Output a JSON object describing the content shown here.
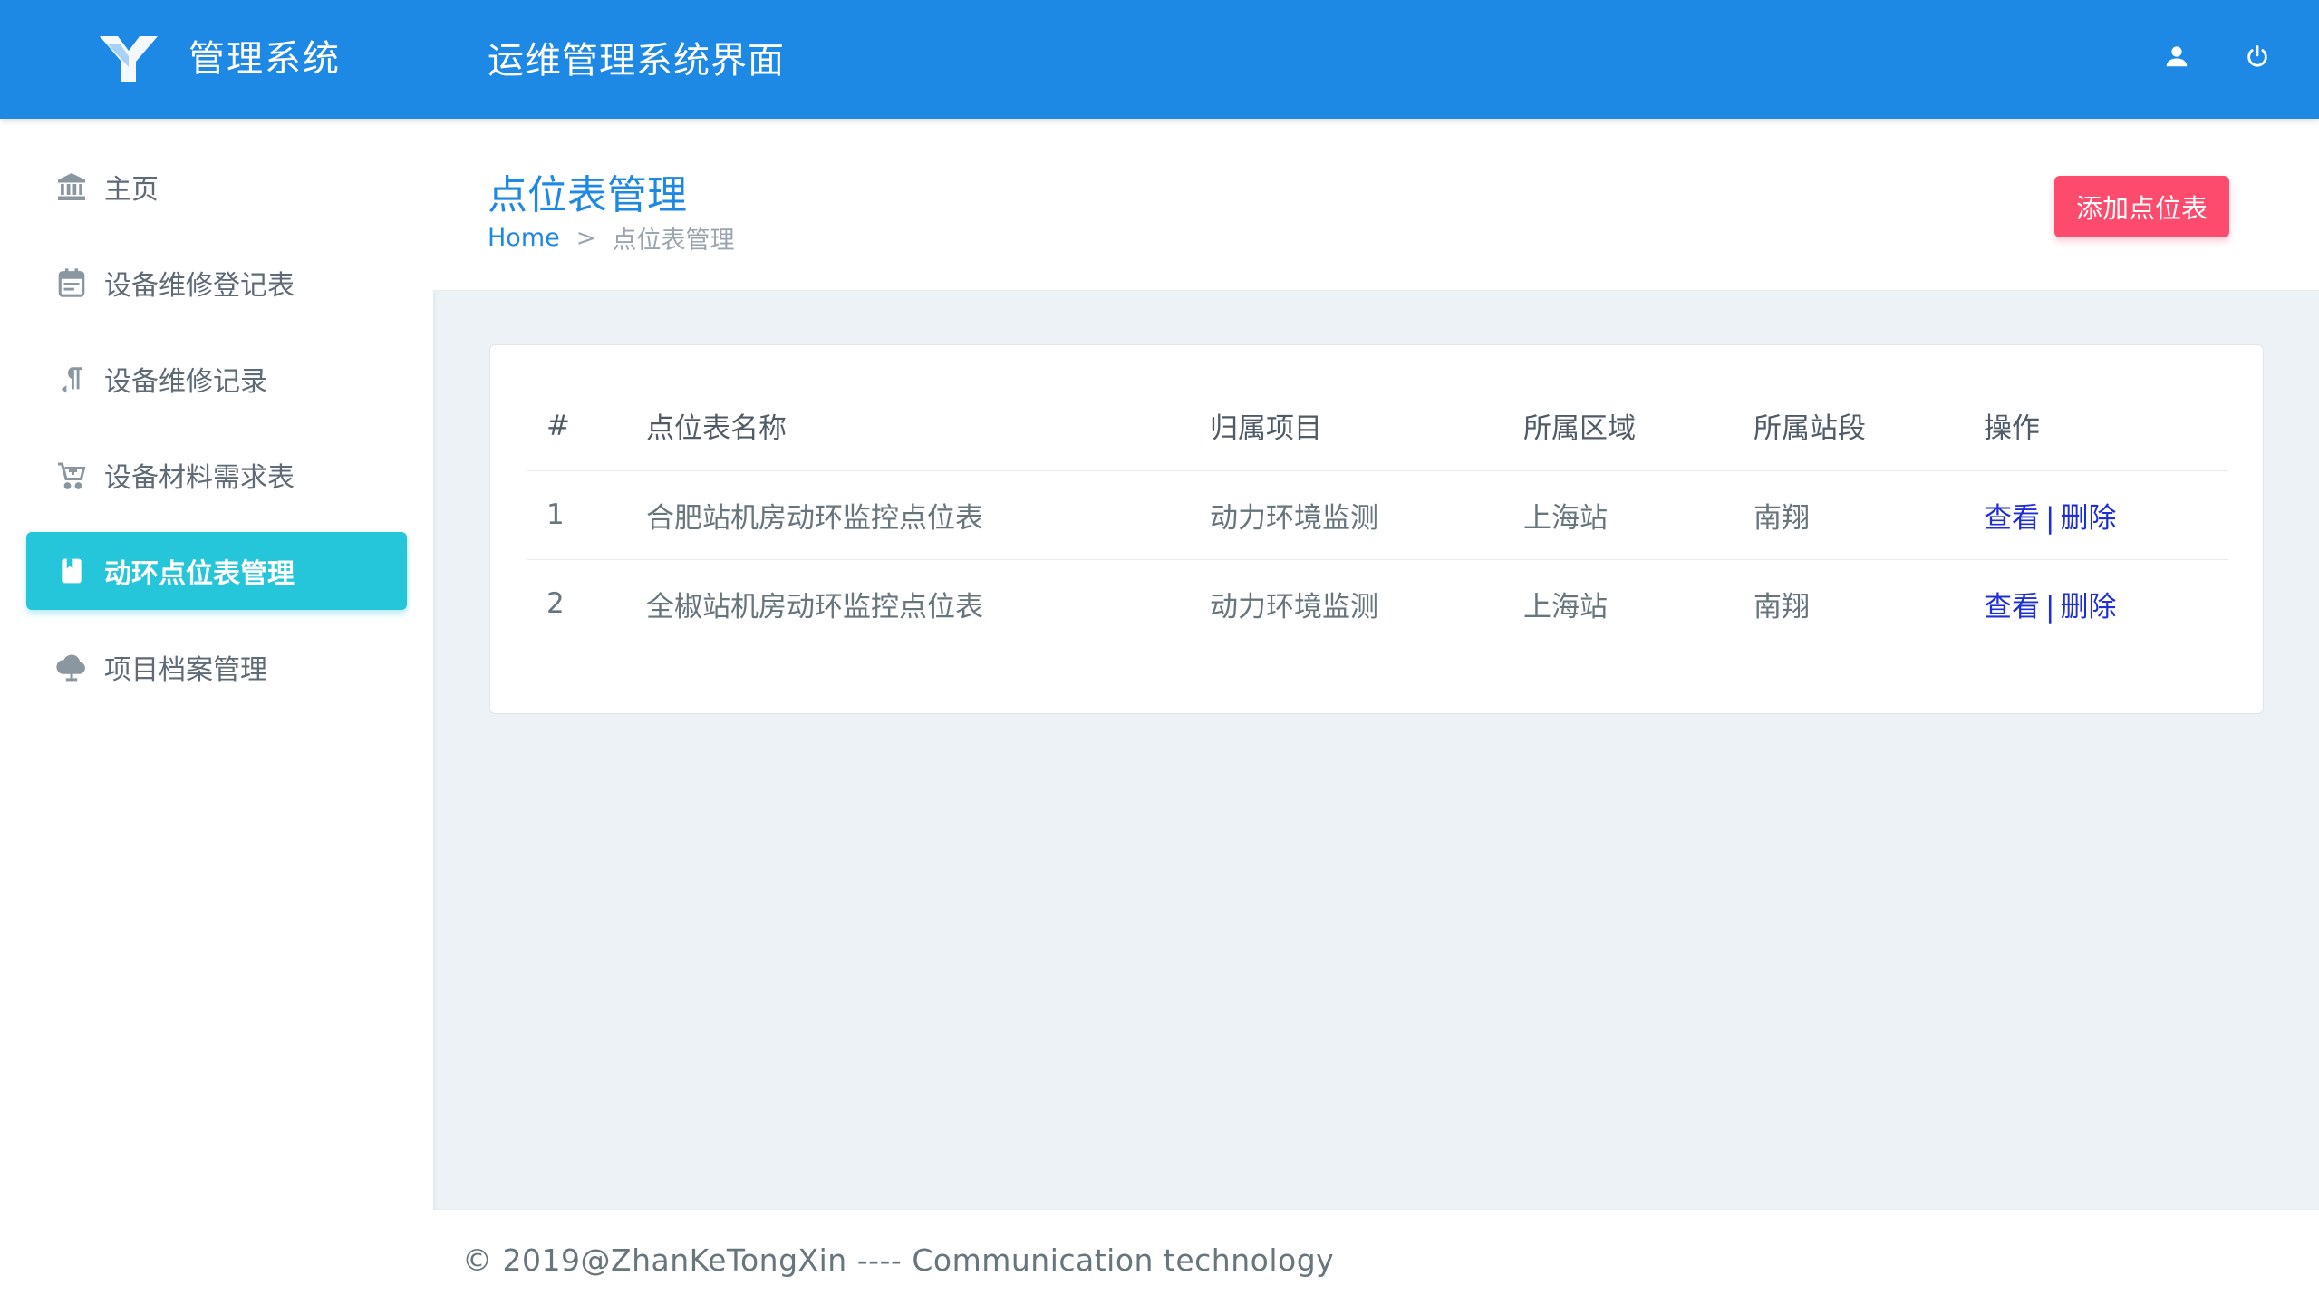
{
  "header": {
    "app_title": "管理系统",
    "page_heading": "运维管理系统界面",
    "icons": [
      "user-icon",
      "power-icon"
    ],
    "accent_color": "#1e88e5"
  },
  "sidebar": {
    "items": [
      {
        "label": "主页",
        "icon": "bank-icon",
        "active": false
      },
      {
        "label": "设备维修登记表",
        "icon": "calendar-icon",
        "active": false
      },
      {
        "label": "设备维修记录",
        "icon": "paragraph-icon",
        "active": false
      },
      {
        "label": "设备材料需求表",
        "icon": "cart-icon",
        "active": false
      },
      {
        "label": "动环点位表管理",
        "icon": "book-icon",
        "active": true
      },
      {
        "label": "项目档案管理",
        "icon": "cloud-icon",
        "active": false
      }
    ],
    "active_color": "#26c6da"
  },
  "main": {
    "title": "点位表管理",
    "breadcrumb": {
      "home": "Home",
      "separator": ">",
      "current": "点位表管理"
    },
    "add_button": "添加点位表",
    "add_button_color": "#fc4b6c"
  },
  "table": {
    "headers": [
      "#",
      "点位表名称",
      "归属项目",
      "所属区域",
      "所属站段",
      "操作"
    ],
    "rows": [
      {
        "index": "1",
        "name": "合肥站机房动环监控点位表",
        "project": "动力环境监测",
        "area": "上海站",
        "section": "南翔",
        "view": "查看",
        "sep": "|",
        "delete": "删除"
      },
      {
        "index": "2",
        "name": "全椒站机房动环监控点位表",
        "project": "动力环境监测",
        "area": "上海站",
        "section": "南翔",
        "view": "查看",
        "sep": "|",
        "delete": "删除"
      }
    ]
  },
  "footer": {
    "text": "© 2019@ZhanKeTongXin ---- Communication technology"
  }
}
